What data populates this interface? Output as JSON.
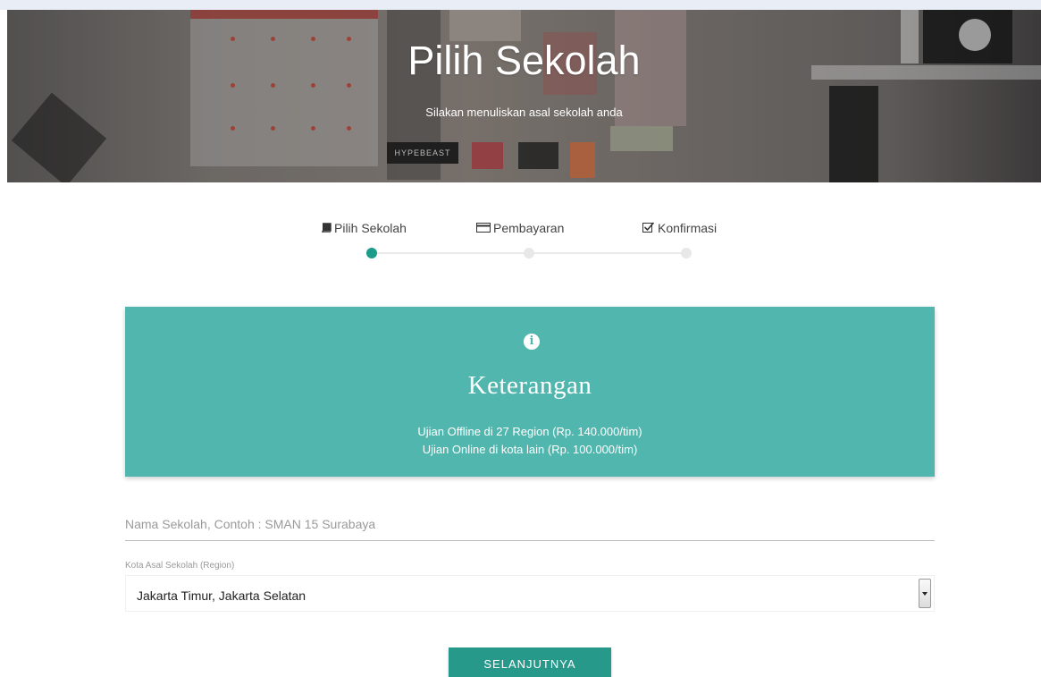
{
  "hero": {
    "title": "Pilih Sekolah",
    "subtitle": "Silakan menuliskan asal sekolah anda",
    "decor_text": "HYPEBEAST"
  },
  "steps": [
    {
      "label": "Pilih Sekolah",
      "icon": "book-icon",
      "active": true
    },
    {
      "label": "Pembayaran",
      "icon": "credit-card-icon",
      "active": false
    },
    {
      "label": "Konfirmasi",
      "icon": "checkbox-icon",
      "active": false
    }
  ],
  "info": {
    "icon": "info-icon",
    "title": "Keterangan",
    "line1": "Ujian Offline di 27 Region (Rp. 140.000/tim)",
    "line2": "Ujian Online di kota lain (Rp. 100.000/tim)"
  },
  "form": {
    "school_placeholder": "Nama Sekolah, Contoh : SMAN 15 Surabaya",
    "school_value": "",
    "region_label": "Kota Asal Sekolah (Region)",
    "region_value": "Jakarta Timur, Jakarta Selatan"
  },
  "next_button_label": "SELANJUTNYA",
  "colors": {
    "accent": "#1c9b8b",
    "info_bg": "#51b6ad",
    "button_bg": "#26998a"
  }
}
